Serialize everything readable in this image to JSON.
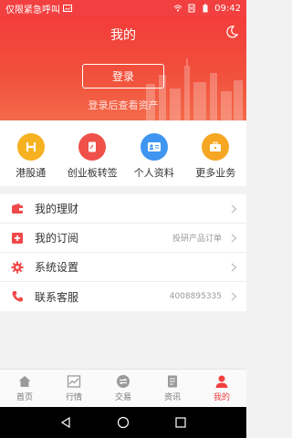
{
  "status_bar": {
    "left_text": "仅限紧急呼叫",
    "time": "09:42"
  },
  "header": {
    "title": "我的",
    "login_button": "登录",
    "login_hint": "登录后查看资产"
  },
  "quick_actions": [
    {
      "label": "港股通",
      "icon": "hk-connect-icon",
      "color": "#f5b120"
    },
    {
      "label": "创业板转签",
      "icon": "document-icon",
      "color": "#f0504a"
    },
    {
      "label": "个人资料",
      "icon": "id-card-icon",
      "color": "#3f95f0"
    },
    {
      "label": "更多业务",
      "icon": "briefcase-icon",
      "color": "#f5a623"
    }
  ],
  "menu": [
    {
      "label": "我的理财",
      "extra": "",
      "icon": "wallet-icon"
    },
    {
      "label": "我的订阅",
      "extra": "投研产品订单",
      "icon": "plus-square-icon"
    },
    {
      "label": "系统设置",
      "extra": "",
      "icon": "gear-icon"
    },
    {
      "label": "联系客服",
      "extra": "4008895335",
      "icon": "phone-icon"
    }
  ],
  "tabs": [
    {
      "label": "首页",
      "icon": "home-icon",
      "active": false
    },
    {
      "label": "行情",
      "icon": "chart-icon",
      "active": false
    },
    {
      "label": "交易",
      "icon": "exchange-icon",
      "active": false
    },
    {
      "label": "资讯",
      "icon": "news-icon",
      "active": false
    },
    {
      "label": "我的",
      "icon": "user-icon",
      "active": true
    }
  ],
  "colors": {
    "brand_red": "#f23f3f",
    "inactive_gray": "#999999"
  }
}
